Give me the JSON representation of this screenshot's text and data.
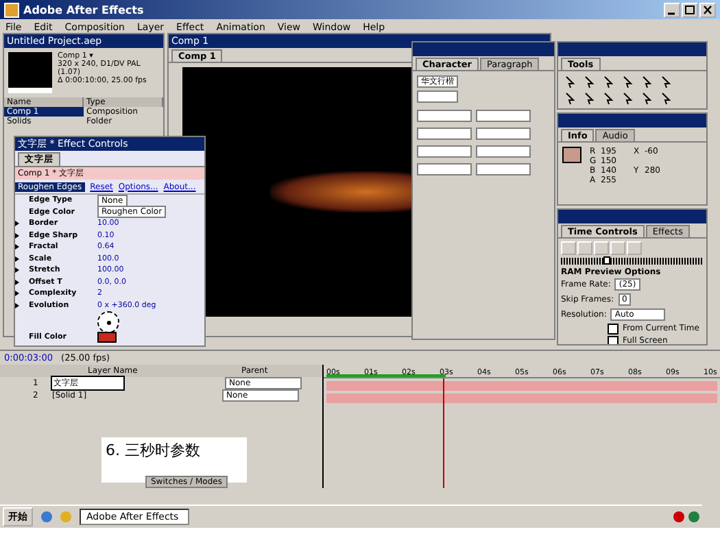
{
  "app_title": "Adobe After Effects",
  "menu": [
    "File",
    "Edit",
    "Composition",
    "Layer",
    "Effect",
    "Animation",
    "View",
    "Window",
    "Help"
  ],
  "project": {
    "title": "Untitled Project.aep",
    "info": [
      "Comp 1 ▾",
      "320 x 240, D1/DV PAL (1.07)",
      "Δ 0:00:10:00, 25.00 fps"
    ],
    "columns": [
      "Name",
      "Type"
    ],
    "items": [
      {
        "name": "Comp 1",
        "type": "Composition",
        "selected": true
      },
      {
        "name": "Solids",
        "type": "Folder",
        "selected": false
      }
    ]
  },
  "comp": {
    "title": "Comp 1",
    "tab": "Comp 1"
  },
  "effect_controls": {
    "title": "文字层 * Effect Controls",
    "tab": "文字层",
    "path": "Comp 1 * 文字层",
    "effect": "Roughen Edges",
    "links": [
      "Reset",
      "Options...",
      "About..."
    ],
    "params": [
      {
        "label": "Edge Type",
        "kind": "dropdown",
        "value": "None"
      },
      {
        "label": "Edge Color",
        "kind": "dropdown",
        "value": "Roughen Color"
      },
      {
        "label": "Border",
        "kind": "value",
        "value": "10.00"
      },
      {
        "label": "Edge Sharp",
        "kind": "value",
        "value": "0.10"
      },
      {
        "label": "Fractal",
        "kind": "value",
        "value": "0.64"
      },
      {
        "label": "Scale",
        "kind": "value",
        "value": "100.0"
      },
      {
        "label": "Stretch",
        "kind": "value",
        "value": "100.00"
      },
      {
        "label": "Offset T",
        "kind": "point",
        "value": "0.0, 0.0"
      },
      {
        "label": "Complexity",
        "kind": "value",
        "value": "2"
      },
      {
        "label": "Evolution",
        "kind": "value",
        "value": "0 x +360.0 deg"
      },
      {
        "kind": "dial"
      },
      {
        "label": "Fill Color",
        "kind": "color",
        "color": "#c8281e"
      }
    ]
  },
  "character": {
    "tabs": [
      {
        "label": "Character",
        "selected": true
      },
      {
        "label": "Paragraph",
        "selected": false
      }
    ],
    "font": "华文行楷"
  },
  "tools": {
    "title": "Tools"
  },
  "info": {
    "tabs": [
      {
        "label": "Info",
        "selected": true
      },
      {
        "label": "Audio",
        "selected": false
      }
    ],
    "color": "#c89a8c",
    "rows": [
      {
        "k": "R",
        "v": "195"
      },
      {
        "k": "G",
        "v": "150"
      },
      {
        "k": "B",
        "v": "140"
      },
      {
        "k": "A",
        "v": "255"
      }
    ],
    "coords": [
      {
        "k": "X",
        "v": "-60"
      },
      {
        "k": "Y",
        "v": "280"
      }
    ]
  },
  "time_controls": {
    "tabs": [
      {
        "label": "Time Controls",
        "selected": true
      },
      {
        "label": "Effects",
        "selected": false
      }
    ],
    "jog": {
      "level": 0.3
    },
    "section": "RAM Preview Options",
    "frame_rate": {
      "label": "Frame Rate:",
      "value": "(25)"
    },
    "skip": {
      "label": "Skip Frames:",
      "value": "0"
    },
    "resolution": {
      "label": "Resolution:",
      "value": "Auto"
    },
    "checks": [
      {
        "label": "From Current Time",
        "checked": false
      },
      {
        "label": "Full Screen",
        "checked": false
      }
    ]
  },
  "timeline": {
    "time": "0:00:03:00",
    "fps": "(25.00 fps)",
    "columns": [
      "Layer Name",
      "Parent"
    ],
    "layers": [
      {
        "num": "1",
        "name": "文字层",
        "parent": "None",
        "selected": true
      },
      {
        "num": "2",
        "name": "[Solid 1]",
        "parent": "None",
        "selected": false
      }
    ],
    "ticks": [
      "00s",
      "01s",
      "02s",
      "03s",
      "04s",
      "05s",
      "06s",
      "07s",
      "08s",
      "09s",
      "10s"
    ],
    "work_area": {
      "level": 0.3
    },
    "switches": "Switches / Modes"
  },
  "caption": "6. 三秒时参数",
  "taskbar": {
    "start": "开始",
    "task": "Adobe After Effects"
  }
}
